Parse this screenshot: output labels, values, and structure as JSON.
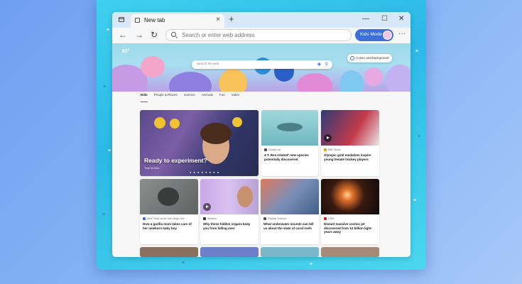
{
  "browser": {
    "tab_title": "New tab",
    "new_tab_symbol": "+",
    "tab_close_symbol": "×",
    "window_controls": {
      "minimize": "—",
      "maximize": "☐",
      "close": "✕"
    },
    "nav": {
      "back": "←",
      "forward": "→",
      "refresh": "↻"
    },
    "address_placeholder": "Search or enter web address",
    "kids_mode_label": "Kids Mode",
    "more_symbol": "···",
    "icons": [
      "tab-actions-icon",
      "page-icon",
      "search-icon",
      "kids-avatar",
      "more-icon"
    ]
  },
  "hero": {
    "weather": "62°",
    "search_placeholder": "Search the web",
    "colors_button_label": "Colors and background"
  },
  "categories": [
    "Kids",
    "People & Places",
    "Science",
    "Animals",
    "Fun",
    "Video"
  ],
  "featured": {
    "title": "Ready to experiment?",
    "source": "Time for Kids",
    "carousel_dots": "● ● ● ● ● ● ● ●"
  },
  "cards_row1": [
    {
      "source": "Global Lab",
      "headline": "4-T. Rex-related* new species potentially discovered"
    },
    {
      "source": "NBC News",
      "headline": "Olympic gold medalists inspire young female hockey players"
    }
  ],
  "cards_row2": [
    {
      "source": "Wild Times at the San Diego Zoo",
      "headline": "How a gorilla mom takes care of her newborn baby boy"
    },
    {
      "source": "Sesame",
      "headline": "Why these hidden organs keep you from falling over"
    },
    {
      "source": "Popular Science",
      "headline": "What underwater sounds can tell us about the state of coral reefs"
    },
    {
      "source": "CNN",
      "headline": "Distant massive cosmic jet discovered from 12 billion light-years away"
    }
  ],
  "colors": {
    "accent": "#3c6fd8",
    "frame": "#2bb8e6",
    "titlebar": "#d7e9f8"
  }
}
